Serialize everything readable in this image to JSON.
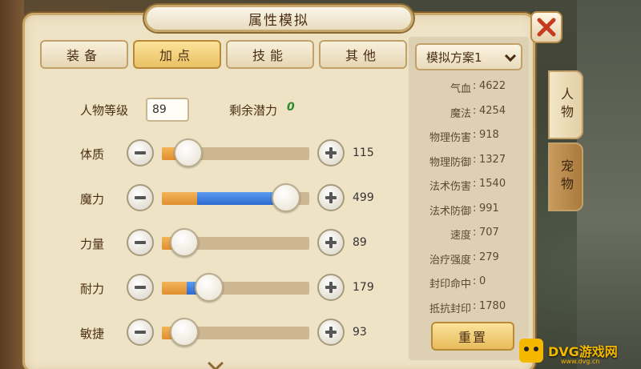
{
  "window": {
    "title": "属性模拟"
  },
  "tabs": [
    {
      "label": "装备",
      "active": false
    },
    {
      "label": "加点",
      "active": true
    },
    {
      "label": "技能",
      "active": false
    },
    {
      "label": "其他",
      "active": false
    }
  ],
  "level": {
    "label": "人物等级",
    "value": "89"
  },
  "potential": {
    "label": "剩余潜力",
    "value": "0"
  },
  "stats": [
    {
      "name": "体质",
      "value": "115",
      "base_fraction": 0.13,
      "extra_fraction": 0.0,
      "knob_fraction": 0.18
    },
    {
      "name": "魔力",
      "value": "499",
      "base_fraction": 0.24,
      "extra_fraction": 0.6,
      "knob_fraction": 0.84
    },
    {
      "name": "力量",
      "value": "89",
      "base_fraction": 0.12,
      "extra_fraction": 0.0,
      "knob_fraction": 0.15
    },
    {
      "name": "耐力",
      "value": "179",
      "base_fraction": 0.17,
      "extra_fraction": 0.08,
      "knob_fraction": 0.32
    },
    {
      "name": "敏捷",
      "value": "93",
      "base_fraction": 0.12,
      "extra_fraction": 0.0,
      "knob_fraction": 0.15
    }
  ],
  "scheme": {
    "selected": "模拟方案1"
  },
  "attributes": [
    {
      "key": "气血",
      "value": "4622"
    },
    {
      "key": "魔法",
      "value": "4254"
    },
    {
      "key": "物理伤害",
      "value": "918"
    },
    {
      "key": "物理防御",
      "value": "1327"
    },
    {
      "key": "法术伤害",
      "value": "1540"
    },
    {
      "key": "法术防御",
      "value": "991"
    },
    {
      "key": "速度",
      "value": "707"
    },
    {
      "key": "治疗强度",
      "value": "279"
    },
    {
      "key": "封印命中",
      "value": "0"
    },
    {
      "key": "抵抗封印",
      "value": "1780"
    }
  ],
  "reset_label": "重置",
  "side_tabs": [
    {
      "label": "人物",
      "active": true
    },
    {
      "label": "宠物",
      "active": false
    }
  ],
  "watermark": {
    "brand": "DVG游戏网",
    "url": "www.dvg.cn"
  },
  "colors": {
    "accent": "#eac064",
    "fill_base": "#e08f2c",
    "fill_extra": "#2f6bd0",
    "potential": "#2c8c2c"
  }
}
